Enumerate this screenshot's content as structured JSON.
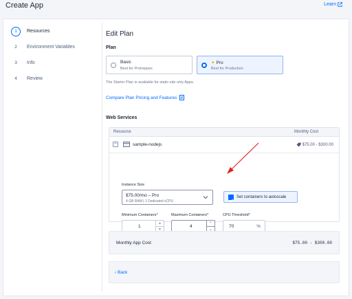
{
  "header": {
    "title": "Create App",
    "learn_label": "Learn"
  },
  "steps": [
    {
      "num": "1",
      "label": "Resources"
    },
    {
      "num": "2",
      "label": "Environment Variables"
    },
    {
      "num": "3",
      "label": "Info"
    },
    {
      "num": "4",
      "label": "Review"
    }
  ],
  "main": {
    "title": "Edit Plan",
    "plan_heading": "Plan",
    "plans": [
      {
        "name": "Basic",
        "sub": "Best for Prototypes"
      },
      {
        "name": "Pro",
        "sub": "Best for Production"
      }
    ],
    "starter_note": "The Starter Plan is available for static-site only Apps.",
    "compare_link": "Compare Plan Pricing and Features",
    "web_services_heading": "Web Services",
    "table": {
      "col_resource": "Resource",
      "col_cost": "Monthly Cost",
      "service_name": "sample-nodejs",
      "service_cost": "$75.00 - $300.00"
    },
    "instance": {
      "label": "Instance Size",
      "value": "$75.00/mo – Pro",
      "sub": "4 GB RAM | 1 Dedicated vCPU"
    },
    "autoscale_label": "Set containers to autoscale",
    "min_label": "Minimum Containers",
    "min_value": "1",
    "max_label": "Maximum Containers",
    "max_value": "4",
    "cpu_label": "CPU Threshold",
    "cpu_value": "70",
    "cpu_unit": "%",
    "required_mark": "*",
    "summary_label": "Monthly App Cost",
    "summary_value": "$75.00 - $300.00",
    "back_label": "Back",
    "back_chevron": "‹"
  },
  "colors": {
    "accent": "#0069ff",
    "annotation_arrow": "#e02424"
  }
}
